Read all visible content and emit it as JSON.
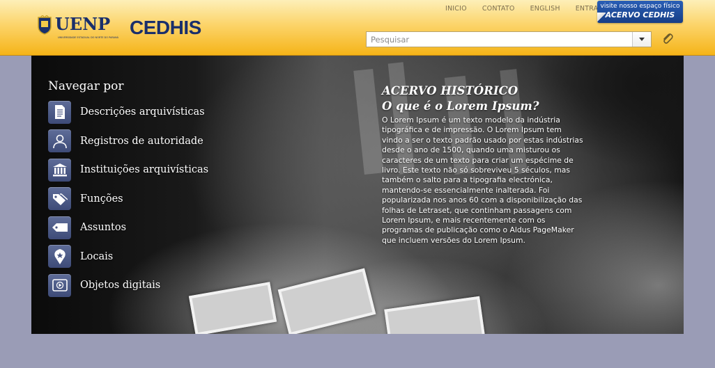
{
  "header": {
    "brand": "UENP",
    "brand_sub": "UNIVERSIDADE ESTADUAL DO NORTE DO PARANÁ",
    "site_title": "CEDHIS",
    "top_nav": [
      "INICIO",
      "CONTATO",
      "ENGLISH",
      "ENTRAR"
    ],
    "badge": {
      "line1": "visite nosso espaço físico",
      "line2": "ACERVO CEDHIS"
    },
    "search": {
      "placeholder": "Pesquisar",
      "value": ""
    }
  },
  "sidebar": {
    "title": "Navegar por",
    "items": [
      {
        "label": "Descrições arquivísticas",
        "icon": "document-icon"
      },
      {
        "label": "Registros de autoridade",
        "icon": "person-icon"
      },
      {
        "label": "Instituições arquivísticas",
        "icon": "institution-icon"
      },
      {
        "label": "Funções",
        "icon": "tags-icon"
      },
      {
        "label": "Assuntos",
        "icon": "tag-icon"
      },
      {
        "label": "Locais",
        "icon": "map-pin-icon"
      },
      {
        "label": "Objetos digitais",
        "icon": "media-icon"
      }
    ]
  },
  "panel": {
    "title": "ACERVO HISTÓRICO",
    "subtitle": "O que é o Lorem Ipsum?",
    "body": "O Lorem Ipsum é um texto modelo da indústria tipográfica e de impressão. O Lorem Ipsum tem vindo a ser o texto padrão usado por estas indústrias desde o ano de 1500, quando uma misturou os caracteres de um texto para criar um espécime de livro. Este texto não só sobreviveu 5 séculos, mas também o salto para a tipografia electrónica, mantendo-se essencialmente inalterada. Foi popularizada nos anos 60 com a disponibilização das folhas de Letraset, que continham passagens com Lorem Ipsum, e mais recentemente com os programas de publicação como o Aldus PageMaker que incluem versões do Lorem Ipsum."
  },
  "colors": {
    "header_top": "#fdefb8",
    "header_bottom": "#f5b418",
    "brand_blue": "#1a2f6b",
    "icon_bg": "#4a5784",
    "page_bg": "#9a9cb6"
  }
}
